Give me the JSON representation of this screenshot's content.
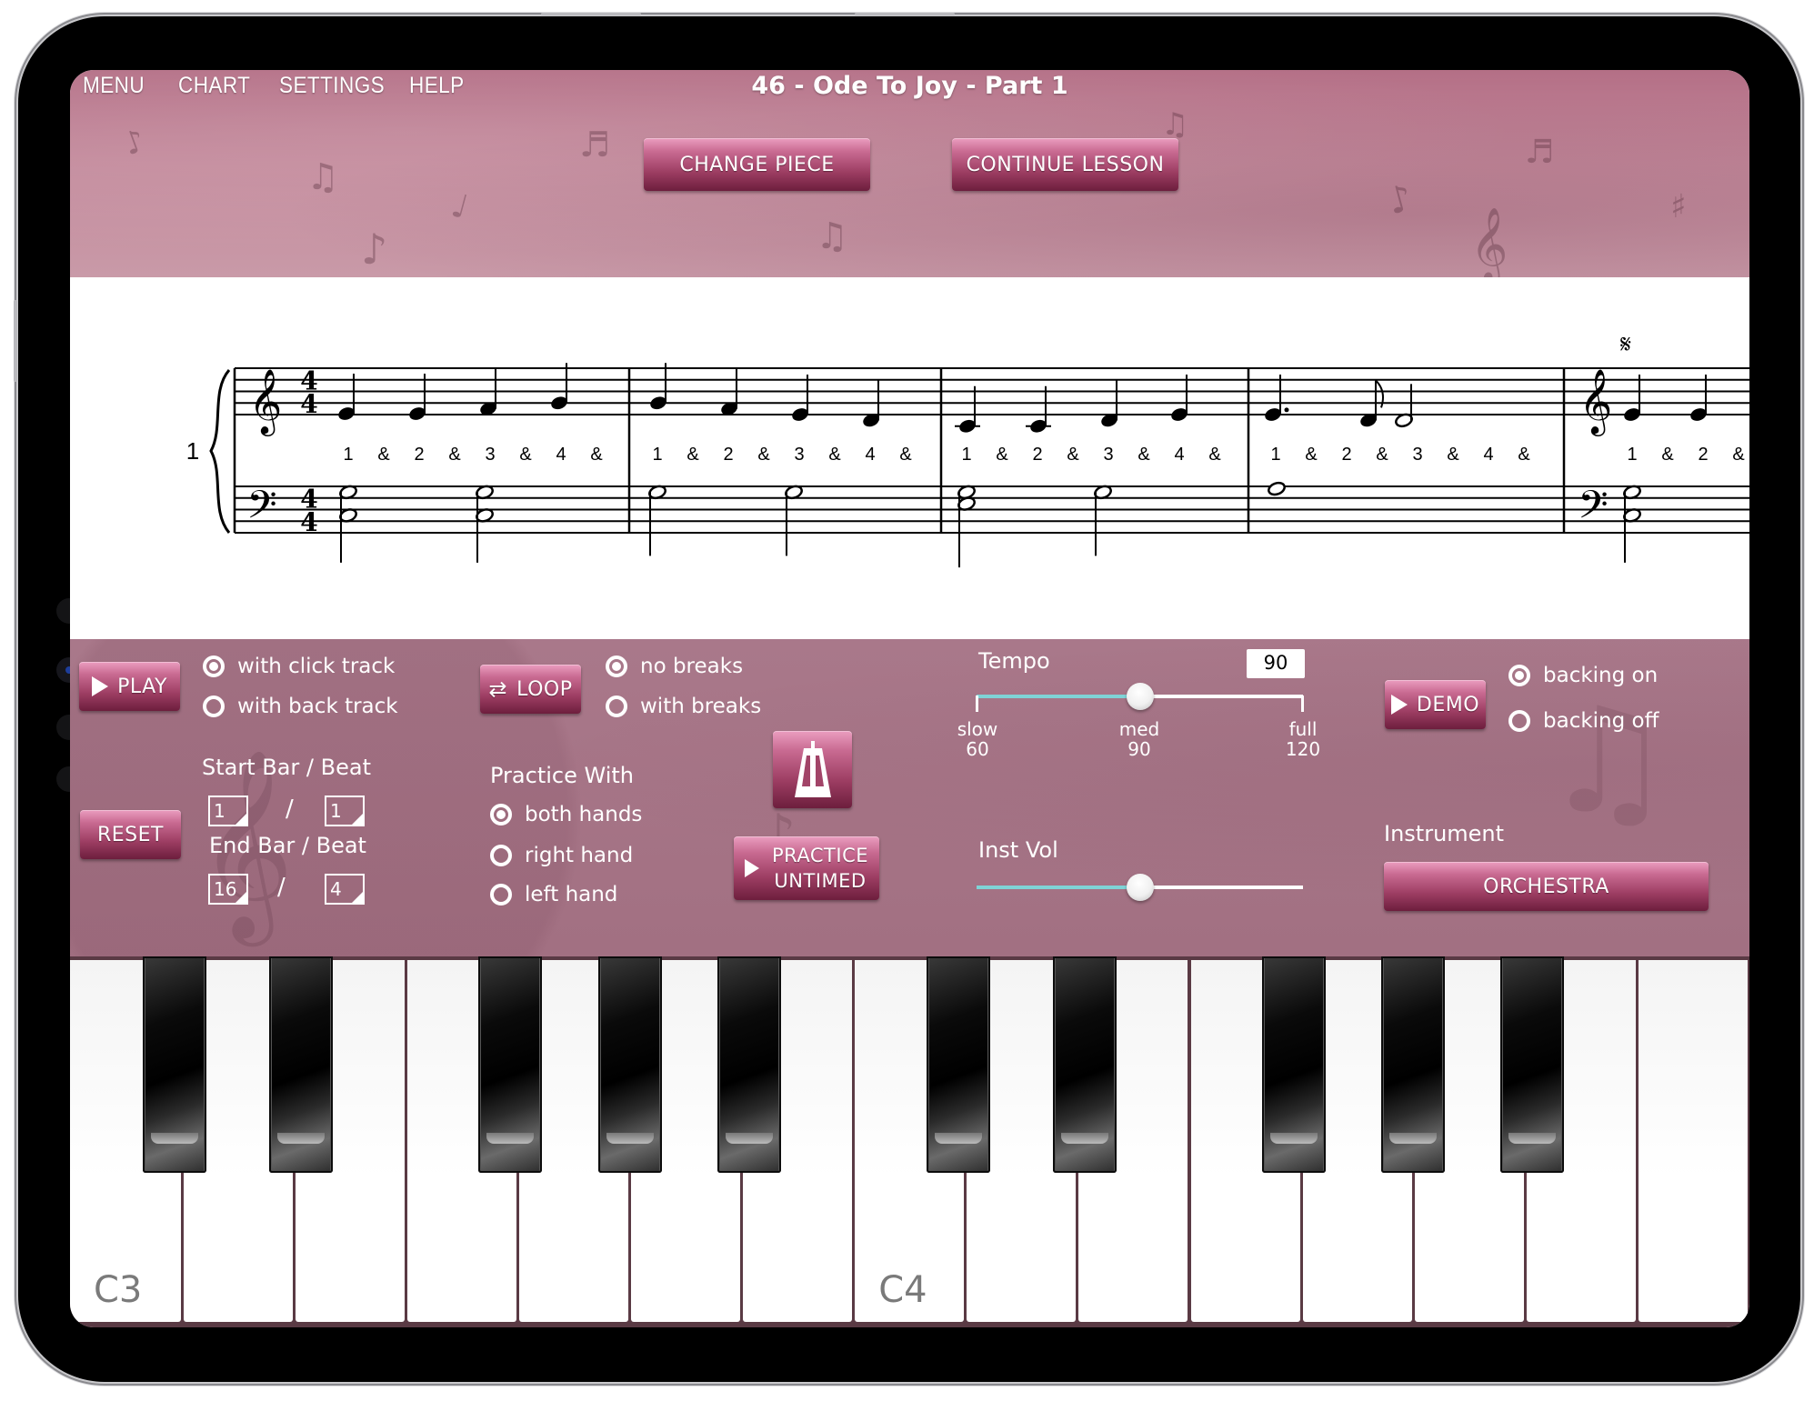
{
  "header": {
    "menu": [
      {
        "id": "menu",
        "label": "MENU"
      },
      {
        "id": "chart",
        "label": "CHART"
      },
      {
        "id": "settings",
        "label": "SETTINGS"
      },
      {
        "id": "help",
        "label": "HELP"
      }
    ],
    "title": "46 - Ode To Joy - Part 1",
    "change_piece": "CHANGE PIECE",
    "continue_lesson": "CONTINUE LESSON"
  },
  "score": {
    "system_number": "1",
    "time_signature": {
      "top": "4",
      "bottom": "4"
    },
    "count_labels": [
      "1",
      "&",
      "2",
      "&",
      "3",
      "&",
      "4",
      "&"
    ],
    "segno": "𝄋",
    "measures": 5
  },
  "controls": {
    "play": "PLAY",
    "reset": "RESET",
    "track_options": [
      {
        "label": "with click track",
        "selected": true
      },
      {
        "label": "with back track",
        "selected": false
      }
    ],
    "start_label": "Start Bar / Beat",
    "start_bar": "1",
    "start_beat": "1",
    "end_label": "End Bar / Beat",
    "end_bar": "16",
    "end_beat": "4",
    "separator": "/",
    "loop": "LOOP",
    "break_options": [
      {
        "label": "no breaks",
        "selected": true
      },
      {
        "label": "with breaks",
        "selected": false
      }
    ],
    "practice_with_label": "Practice With",
    "hand_options": [
      {
        "label": "both hands",
        "selected": true
      },
      {
        "label": "right hand",
        "selected": false
      },
      {
        "label": "left hand",
        "selected": false
      }
    ],
    "practice_untimed_line1": "PRACTICE",
    "practice_untimed_line2": "UNTIMED",
    "tempo": {
      "label": "Tempo",
      "value": "90",
      "min": 60,
      "max": 120,
      "current": 90,
      "marks": [
        {
          "name": "slow",
          "value": "60"
        },
        {
          "name": "med",
          "value": "90"
        },
        {
          "name": "full",
          "value": "120"
        }
      ]
    },
    "inst_vol": {
      "label": "Inst Vol",
      "fraction": 0.5
    },
    "demo": "DEMO",
    "backing_options": [
      {
        "label": "backing on",
        "selected": true
      },
      {
        "label": "backing off",
        "selected": false
      }
    ],
    "instrument_label": "Instrument",
    "instrument": "ORCHESTRA"
  },
  "keyboard": {
    "labels": {
      "c3": "C3",
      "c4": "C4"
    }
  },
  "colors": {
    "accent_button": "#9c3d62",
    "slider_fill": "#7fd3d6",
    "panel": "#a9788a"
  }
}
